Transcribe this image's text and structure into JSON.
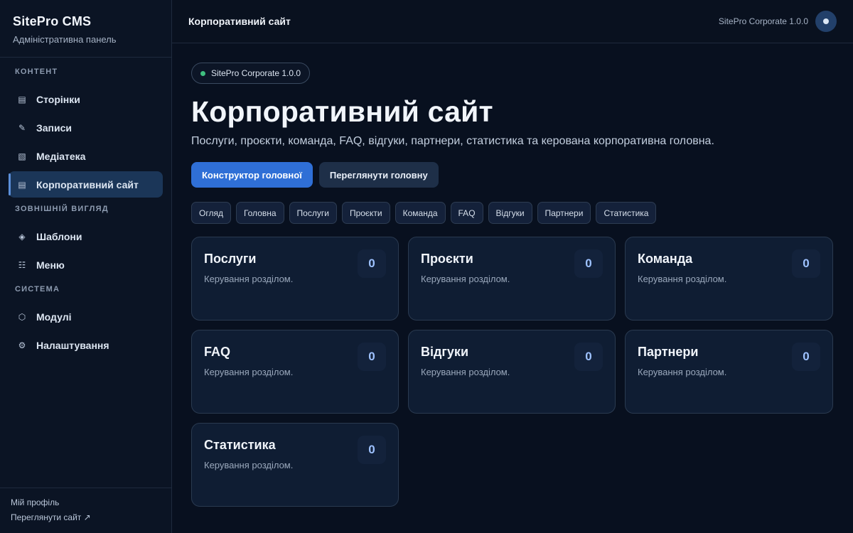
{
  "brand": {
    "title": "SitePro CMS",
    "subtitle": "Адміністративна панель"
  },
  "sidebar": {
    "sections": [
      {
        "label": "КОНТЕНТ",
        "items": [
          {
            "label": "Сторінки",
            "icon": "pages-icon"
          },
          {
            "label": "Записи",
            "icon": "pencil-icon"
          },
          {
            "label": "Медіатека",
            "icon": "media-icon"
          },
          {
            "label": "Корпоративний сайт",
            "icon": "corporate-icon",
            "active": true
          }
        ]
      },
      {
        "label": "ЗОВНІШНІЙ ВИГЛЯД",
        "items": [
          {
            "label": "Шаблони",
            "icon": "diamond-icon"
          },
          {
            "label": "Меню",
            "icon": "menu-icon"
          }
        ]
      },
      {
        "label": "СИСТЕМА",
        "items": [
          {
            "label": "Модулі",
            "icon": "module-icon"
          },
          {
            "label": "Налаштування",
            "icon": "gear-icon"
          }
        ]
      }
    ],
    "footer": {
      "profile": "Мій профіль",
      "view_site": "Переглянути сайт ↗"
    }
  },
  "topbar": {
    "title": "Корпоративний сайт",
    "version": "SitePro Corporate 1.0.0"
  },
  "main": {
    "status": "SitePro Corporate 1.0.0",
    "title": "Корпоративний сайт",
    "description": "Послуги, проєкти, команда, FAQ, відгуки, партнери, статистика та керована корпоративна головна.",
    "actions": {
      "primary": "Конструктор головної",
      "secondary": "Переглянути головну"
    },
    "tabs": [
      "Огляд",
      "Головна",
      "Послуги",
      "Проєкти",
      "Команда",
      "FAQ",
      "Відгуки",
      "Партнери",
      "Статистика"
    ],
    "cards": [
      {
        "title": "Послуги",
        "subtitle": "Керування розділом.",
        "count": "0"
      },
      {
        "title": "Проєкти",
        "subtitle": "Керування розділом.",
        "count": "0"
      },
      {
        "title": "Команда",
        "subtitle": "Керування розділом.",
        "count": "0"
      },
      {
        "title": "FAQ",
        "subtitle": "Керування розділом.",
        "count": "0"
      },
      {
        "title": "Відгуки",
        "subtitle": "Керування розділом.",
        "count": "0"
      },
      {
        "title": "Партнери",
        "subtitle": "Керування розділом.",
        "count": "0"
      },
      {
        "title": "Статистика",
        "subtitle": "Керування розділом.",
        "count": "0"
      }
    ]
  },
  "colors": {
    "accent": "#2f6fd6",
    "status": "#3fbf7f",
    "background": "#08101f"
  }
}
